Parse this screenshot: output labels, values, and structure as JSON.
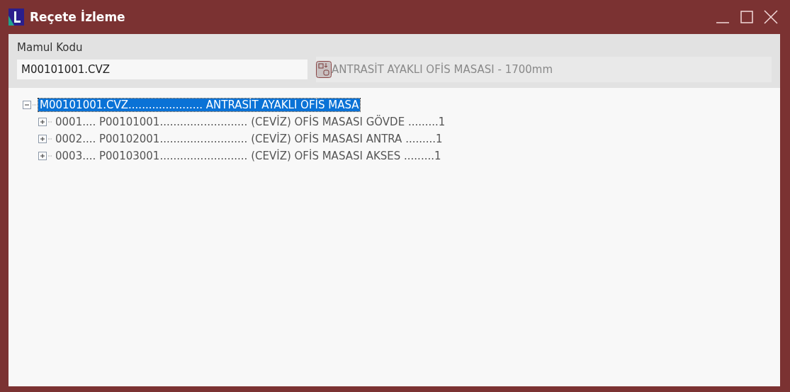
{
  "window": {
    "title": "Reçete İzleme"
  },
  "form": {
    "label": "Mamul Kodu",
    "value": "M00101001.CVZ",
    "description": "ANTRASİT AYAKLI OFİS MASASI - 1700mm"
  },
  "tree": [
    {
      "label": "M00101001.CVZ...................... ANTRASİT AYAKLI OFİS MASA",
      "expanded": true,
      "selected": true,
      "children": [
        {
          "label": "0001.... P00101001.......................... (CEVİZ) OFİS MASASI GÖVDE .........1",
          "expanded": false,
          "selected": false
        },
        {
          "label": "0002.... P00102001.......................... (CEVİZ) OFİS MASASI ANTRA .........1",
          "expanded": false,
          "selected": false
        },
        {
          "label": "0003.... P00103001.......................... (CEVİZ) OFİS MASASI AKSES .........1",
          "expanded": false,
          "selected": false
        }
      ]
    }
  ]
}
